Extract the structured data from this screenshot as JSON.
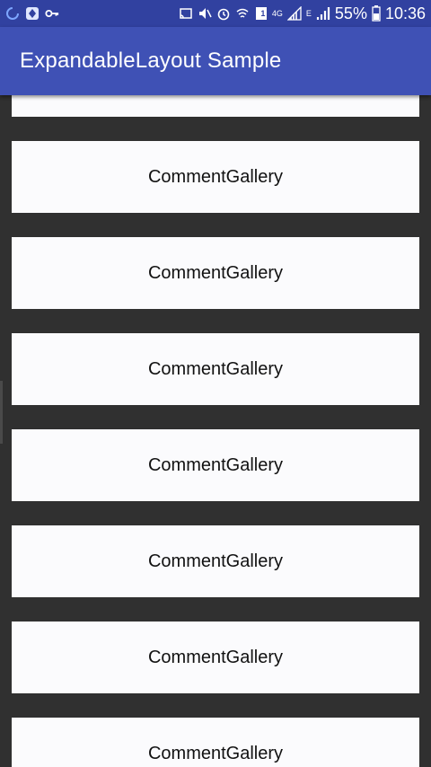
{
  "status_bar": {
    "battery_percent": "55%",
    "time": "10:36",
    "network_type": "4G",
    "signal_type": "E",
    "sim_slot": "1",
    "icons": [
      "sync-icon",
      "app-notification-icon",
      "key-icon",
      "cast-icon",
      "mute-icon",
      "alarm-icon",
      "wifi-icon",
      "sim-icon",
      "signal-icon",
      "battery-icon"
    ]
  },
  "app_bar": {
    "title": "ExpandableLayout Sample"
  },
  "list": {
    "items": [
      {
        "label": ""
      },
      {
        "label": "CommentGallery"
      },
      {
        "label": "CommentGallery"
      },
      {
        "label": "CommentGallery"
      },
      {
        "label": "CommentGallery"
      },
      {
        "label": "CommentGallery"
      },
      {
        "label": "CommentGallery"
      },
      {
        "label": "CommentGallery"
      }
    ]
  },
  "colors": {
    "primary": "#3f51b5",
    "status_bar": "#3141a0",
    "background": "#303030",
    "card": "#fbfbfd"
  }
}
